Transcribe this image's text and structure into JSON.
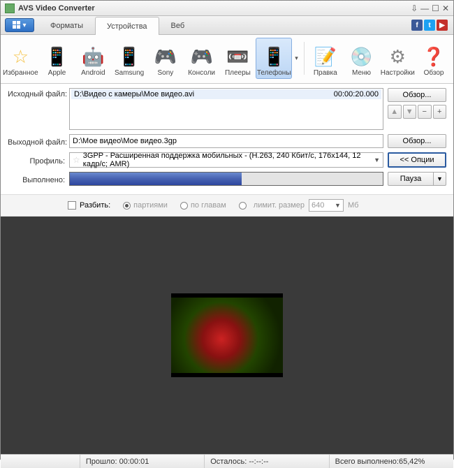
{
  "title": "AVS Video Converter",
  "tabs": {
    "formats": "Форматы",
    "devices": "Устройства",
    "web": "Веб"
  },
  "toolbar": {
    "favorites": "Избранное",
    "apple": "Apple",
    "android": "Android",
    "samsung": "Samsung",
    "sony": "Sony",
    "consoles": "Консоли",
    "players": "Плееры",
    "phones": "Телефоны",
    "edit": "Правка",
    "menu": "Меню",
    "settings": "Настройки",
    "about": "Обзор"
  },
  "labels": {
    "source": "Исходный файл:",
    "output": "Выходной файл:",
    "profile": "Профиль:",
    "done": "Выполнено:",
    "browse": "Обзор...",
    "options": "<< Опции",
    "pause": "Пауза",
    "split": "Разбить:",
    "by_parts": "партиями",
    "by_chapters": "по главам",
    "limit_size": "лимит. размер",
    "mb": "Мб"
  },
  "source_file": {
    "path": "D:\\Видео с камеры\\Мое видео.avi",
    "duration": "00:00:20.000"
  },
  "output_file": "D:\\Мое видео\\Мое видео.3gp",
  "profile": "3GPP - Расширенная поддержка мобильных - (H.263, 240 Кбит/с, 176x144, 12 кадр/с; AMR)",
  "split_size": "640",
  "status": {
    "elapsed_label": "Прошло:",
    "elapsed": "00:00:01",
    "remaining_label": "Осталось:",
    "remaining": "--:--:--",
    "total_label": "Всего выполнено:",
    "total": "65,42%"
  },
  "icons": {
    "favorites": "☆",
    "apple": "📱",
    "android": "🤖",
    "samsung": "📱",
    "sony": "🎮",
    "consoles": "🎮",
    "players": "📼",
    "phones": "📱",
    "edit": "📝",
    "menu": "💿",
    "settings": "⚙",
    "about": "❓"
  }
}
